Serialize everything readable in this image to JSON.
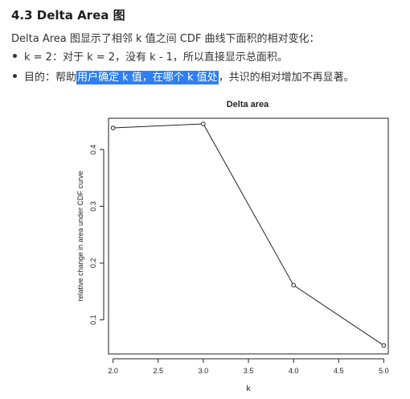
{
  "section": {
    "heading": "4.3 Delta Area 图",
    "intro": "Delta Area 图显示了相邻 k 值之间 CDF 曲线下面积的相对变化：",
    "bullets": [
      {
        "text": "k = 2：对于 k = 2，没有 k - 1，所以直接显示总面积。"
      },
      {
        "prefix": "目的：帮助",
        "highlight": "用户确定 k 值，在哪个 k 值处",
        "suffix": "，共识的相对增加不再显著。"
      }
    ]
  },
  "chart_data": {
    "type": "line",
    "title": "Delta area",
    "xlabel": "k",
    "ylabel": "relative change in area under CDF curve",
    "x": [
      2,
      3,
      4,
      5
    ],
    "y": [
      0.438,
      0.445,
      0.161,
      0.055
    ],
    "xlim": [
      1.95,
      5.05
    ],
    "ylim": [
      0.04,
      0.455
    ],
    "xticks": [
      2.0,
      2.5,
      3.0,
      3.5,
      4.0,
      4.5,
      5.0
    ],
    "xtick_labels": [
      "2.0",
      "2.5",
      "3.0",
      "3.5",
      "4.0",
      "4.5",
      "5.0"
    ],
    "yticks": [
      0.1,
      0.2,
      0.3,
      0.4
    ],
    "ytick_labels": [
      "0.1",
      "0.2",
      "0.3",
      "0.4"
    ],
    "markers": "open-circle",
    "grid": false,
    "legend": "none"
  }
}
